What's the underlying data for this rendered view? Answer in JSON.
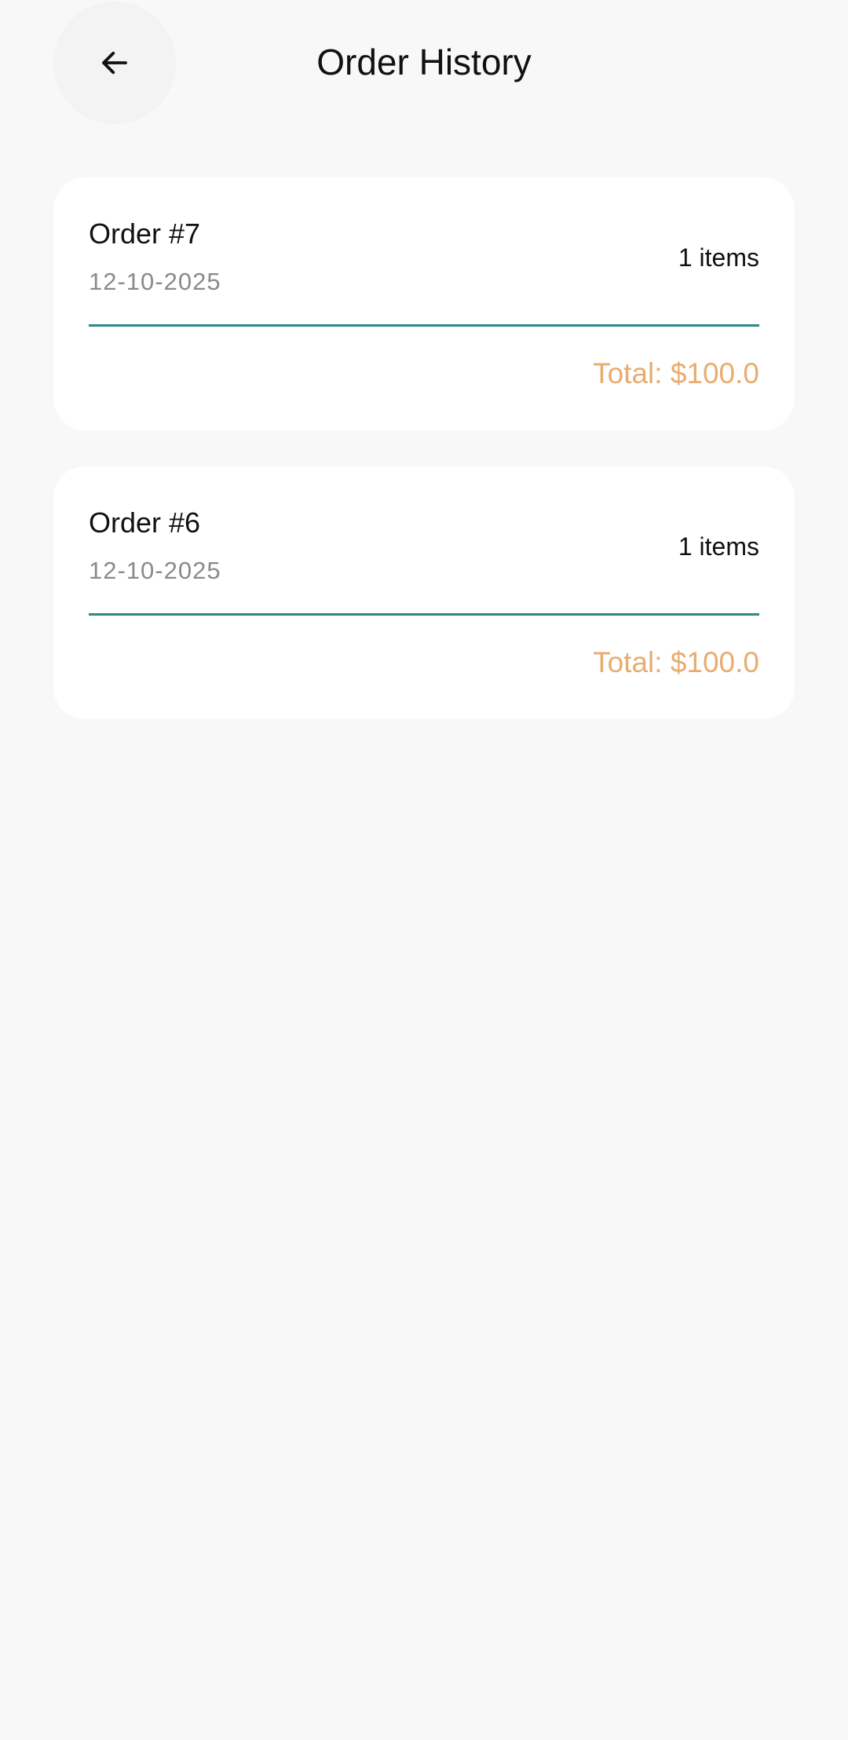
{
  "header": {
    "title": "Order History",
    "back_icon": "arrow-left-icon"
  },
  "orders": [
    {
      "title": "Order #7",
      "date": "12-10-2025",
      "items": "1 items",
      "total": "Total: $100.0"
    },
    {
      "title": "Order #6",
      "date": "12-10-2025",
      "items": "1 items",
      "total": "Total: $100.0"
    }
  ],
  "colors": {
    "background": "#f8f8f8",
    "card": "#ffffff",
    "divider": "#2a8a84",
    "total": "#e8ac70",
    "date": "#8a8a8a"
  }
}
